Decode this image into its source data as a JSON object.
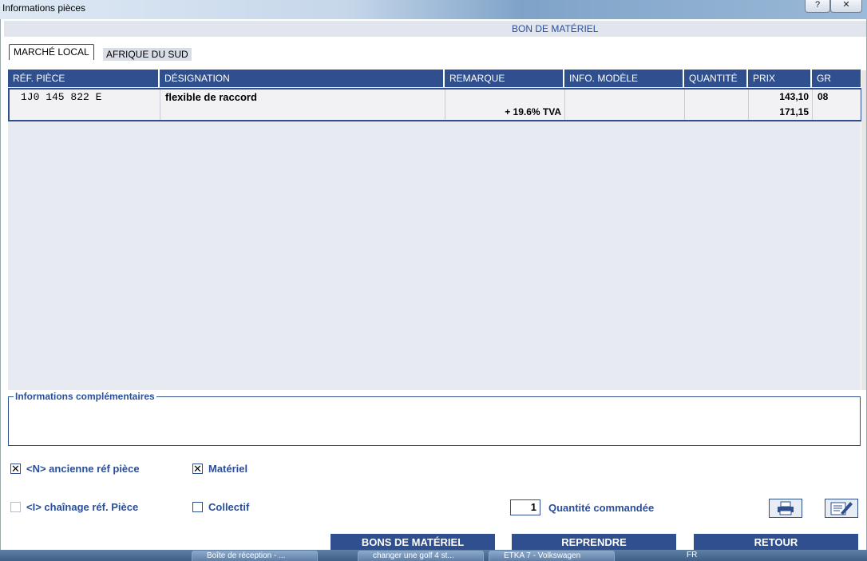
{
  "window": {
    "title": "Informations pièces",
    "help": "?",
    "close": "✕"
  },
  "header": {
    "title": "BON DE MATÉRIEL"
  },
  "tabs": [
    {
      "label": "MARCHÉ LOCAL",
      "active": true
    },
    {
      "label": "AFRIQUE DU SUD",
      "active": false
    }
  ],
  "table": {
    "columns": [
      "RÉF. PIÈCE",
      "DÉSIGNATION",
      "REMARQUE",
      "INFO. MODÈLE",
      "QUANTITÉ",
      "PRIX",
      "GR"
    ],
    "row": {
      "ref": "1J0 145 822 E",
      "designation": "flexible de raccord",
      "remarque": "+ 19.6% TVA",
      "info_modele": "",
      "quantite": "",
      "prix": "143,10",
      "prix_tva": "171,15",
      "gr": "08"
    }
  },
  "info": {
    "label": "Informations complémentaires"
  },
  "options": {
    "ancienne_ref": {
      "label": "<N> ancienne réf pièce",
      "checked": true
    },
    "materiel": {
      "label": "Matériel",
      "checked": true
    },
    "chainage": {
      "label": "<I> chaînage réf. Pièce",
      "checked": false
    },
    "collectif": {
      "label": "Collectif",
      "checked": false
    }
  },
  "quantity": {
    "value": "1",
    "label": "Quantité commandée"
  },
  "buttons": {
    "bons": "BONS DE MATÉRIEL",
    "reprendre": "REPRENDRE",
    "retour": "RETOUR"
  },
  "taskbar": {
    "items": [
      "Boîte de réception - ...",
      "changer une golf 4 st...",
      "ETKA 7 - Volkswagen"
    ],
    "lang": "FR"
  },
  "colors": {
    "accent": "#2f4f8f",
    "label": "#2a4e9a"
  }
}
